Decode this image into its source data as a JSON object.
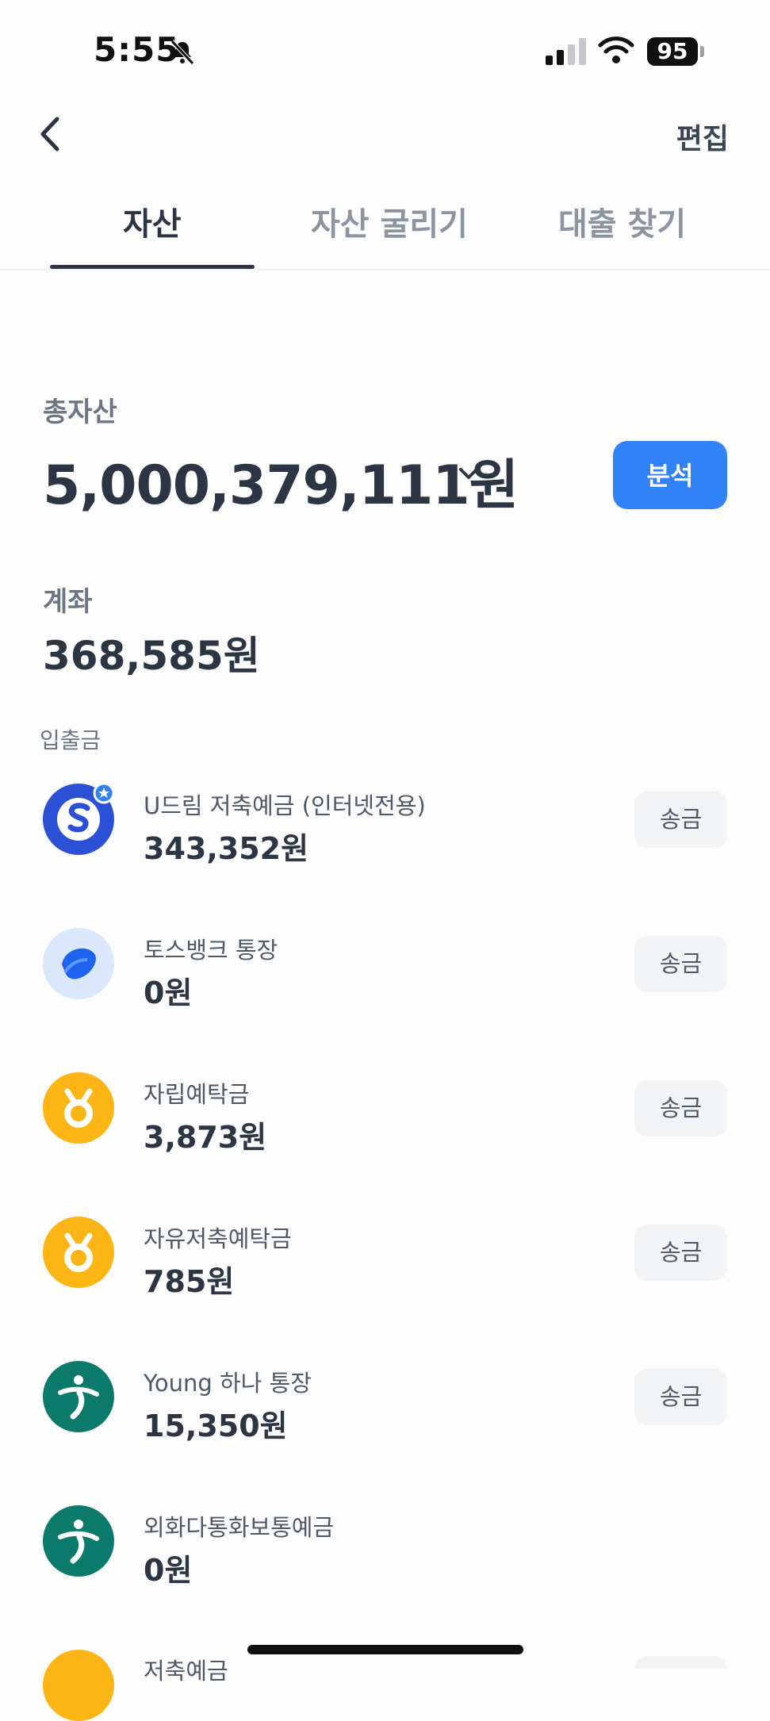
{
  "status_bar": {
    "time": "5:55",
    "battery": "95"
  },
  "header": {
    "edit_label": "편집"
  },
  "tabs": [
    {
      "label": "자산"
    },
    {
      "label": "자산 굴리기"
    },
    {
      "label": "대출 찾기"
    }
  ],
  "total": {
    "label": "총자산",
    "amount": "5,000,379,111원",
    "analyze_label": "분석"
  },
  "accounts": {
    "label": "계좌",
    "amount": "368,585원",
    "section": "입출금"
  },
  "rows": [
    {
      "name": "U드림 저축예금 (인터넷전용)",
      "amount": "343,352원",
      "send": "송금"
    },
    {
      "name": "토스뱅크 통장",
      "amount": "0원",
      "send": "송금"
    },
    {
      "name": "자립예탁금",
      "amount": "3,873원",
      "send": "송금"
    },
    {
      "name": "자유저축예탁금",
      "amount": "785원",
      "send": "송금"
    },
    {
      "name": "Young 하나 통장",
      "amount": "15,350원",
      "send": "송금"
    },
    {
      "name": "외화다통화보통예금",
      "amount": "0원"
    },
    {
      "name": "저축예금"
    }
  ],
  "colors": {
    "accent": "#3182f6",
    "shinhan": "#2b50d6",
    "toss": "#1e63f0",
    "mg": "#fbb514",
    "hana": "#0b7a6a"
  }
}
